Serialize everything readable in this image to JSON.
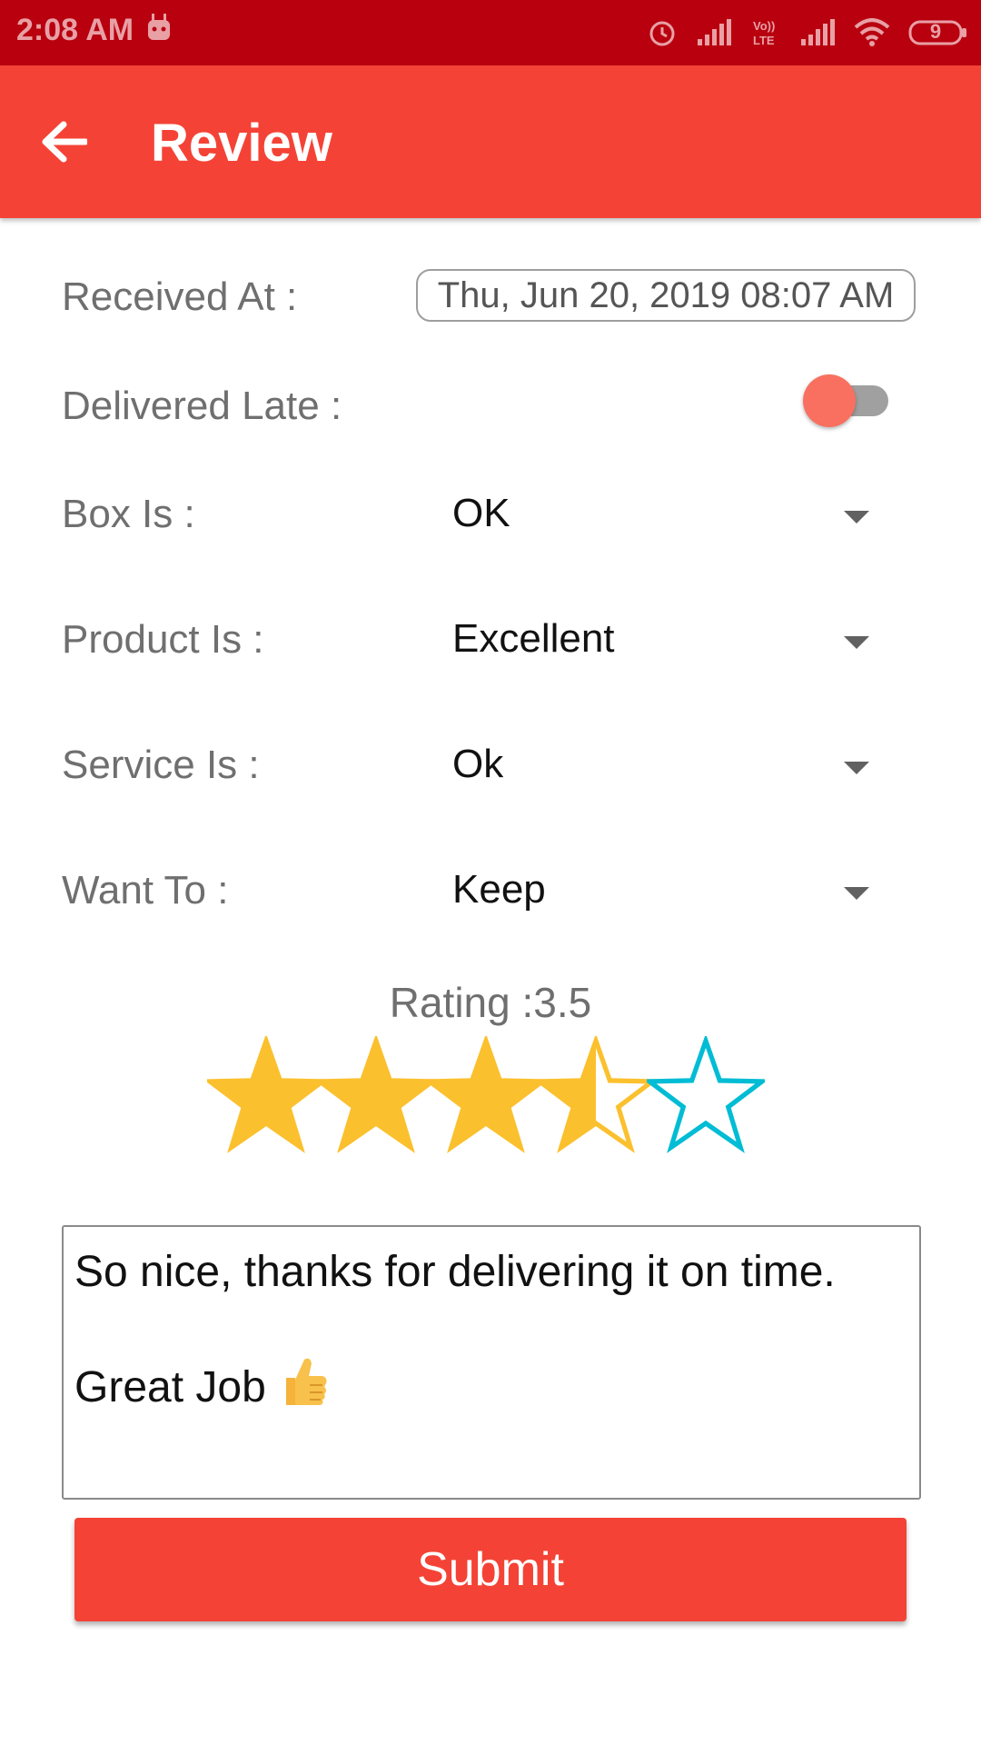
{
  "status_bar": {
    "time": "2:08 AM",
    "battery": "9",
    "icons": [
      "android-icon",
      "alarm-icon",
      "signal-icon",
      "volte-icon",
      "signal-icon",
      "wifi-icon",
      "battery-icon"
    ],
    "color": "#b8000f"
  },
  "app_bar": {
    "title": "Review",
    "color": "#f44336"
  },
  "form": {
    "received_at": {
      "label": "Received At :",
      "value": "Thu, Jun 20, 2019 08:07 AM"
    },
    "delivered_late": {
      "label": "Delivered Late :",
      "checked": false
    },
    "box_is": {
      "label": "Box Is :",
      "value": "OK"
    },
    "product_is": {
      "label": "Product Is :",
      "value": "Excellent"
    },
    "service_is": {
      "label": "Service Is :",
      "value": "Ok"
    },
    "want_to": {
      "label": "Want To :",
      "value": "Keep"
    }
  },
  "rating": {
    "label": "Rating :3.5",
    "value": 3.5,
    "max": 5,
    "filled_color": "#fbc02d",
    "empty_color": "#00bcd4"
  },
  "review": {
    "line1": "So nice, thanks for delivering it on time.",
    "line2": "Great Job",
    "emoji": "thumbs-up-icon"
  },
  "submit": {
    "label": "Submit"
  }
}
